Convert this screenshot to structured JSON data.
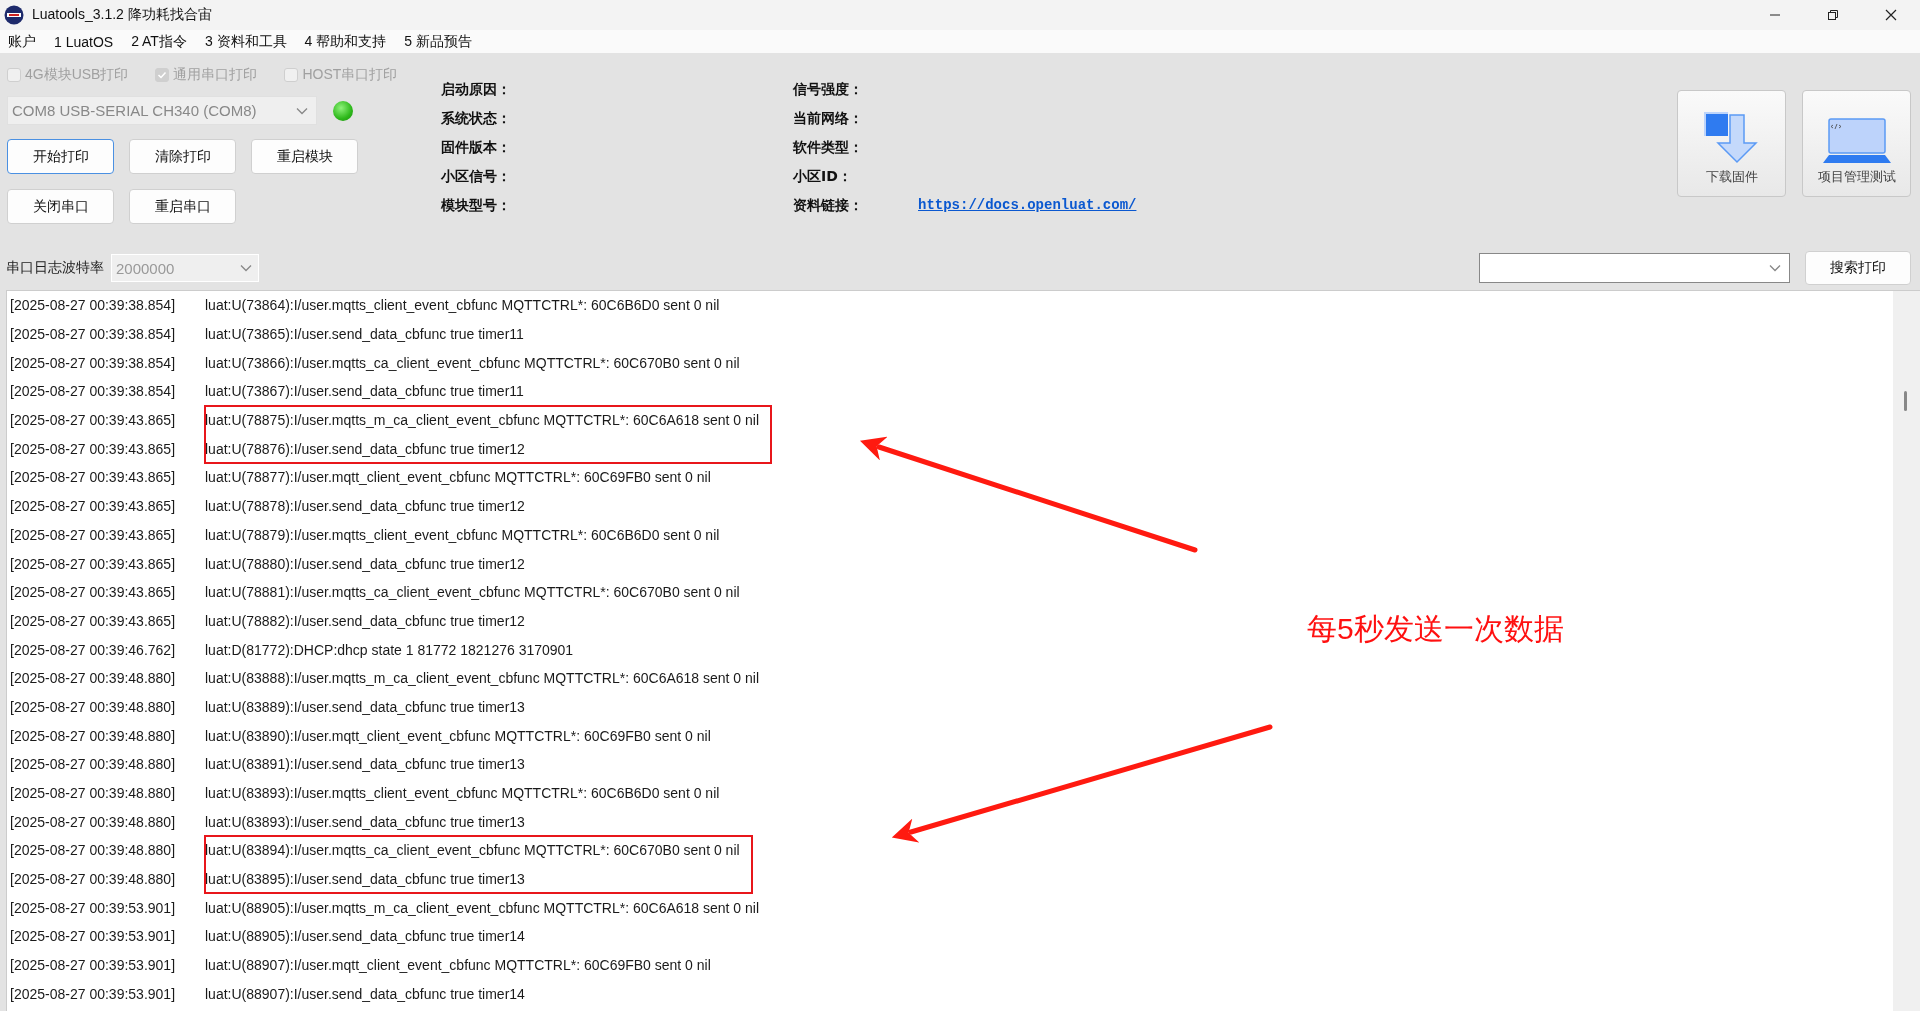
{
  "window": {
    "title": "Luatools_3.1.2 降功耗找合宙"
  },
  "menu": [
    "账户",
    "1 LuatOS",
    "2 AT指令",
    "3 资料和工具",
    "4 帮助和支持",
    "5 新品预告"
  ],
  "print_options": [
    {
      "label": "4G模块USB打印",
      "checked": false,
      "disabled": true
    },
    {
      "label": "通用串口打印",
      "checked": true,
      "disabled": true
    },
    {
      "label": "HOST串口打印",
      "checked": false,
      "disabled": true
    }
  ],
  "port": {
    "value": "COM8 USB-SERIAL CH340 (COM8)",
    "disabled": true,
    "connected": true
  },
  "buttons": [
    [
      {
        "label": "开始打印",
        "focused": true
      },
      {
        "label": "清除打印",
        "focused": false
      },
      {
        "label": "重启模块",
        "focused": false
      }
    ],
    [
      {
        "label": "关闭串口",
        "focused": false
      },
      {
        "label": "重启串口",
        "focused": false
      }
    ]
  ],
  "status_left": [
    "启动原因：",
    "系统状态：",
    "固件版本：",
    "小区信号：",
    "模块型号："
  ],
  "status_right": [
    {
      "label": "信号强度："
    },
    {
      "label": "当前网络："
    },
    {
      "label": "软件类型："
    },
    {
      "label": "小区ID："
    },
    {
      "label": "资料链接：",
      "link": "https://docs.openluat.com/"
    }
  ],
  "tools": [
    {
      "kind": "download",
      "label": "下载固件"
    },
    {
      "kind": "project",
      "label": "项目管理测试"
    }
  ],
  "baud": {
    "label": "串口日志波特率",
    "value": "2000000"
  },
  "search": {
    "button": "搜索打印"
  },
  "log": [
    {
      "timestamp": "[2025-08-27 00:39:38.854]",
      "message": "luat:U(73864):I/user.mqtts_client_event_cbfunc MQTTCTRL*: 60C6B6D0 sent 0 nil",
      "highlighted": false
    },
    {
      "timestamp": "[2025-08-27 00:39:38.854]",
      "message": "luat:U(73865):I/user.send_data_cbfunc true timer11",
      "highlighted": false
    },
    {
      "timestamp": "[2025-08-27 00:39:38.854]",
      "message": "luat:U(73866):I/user.mqtts_ca_client_event_cbfunc MQTTCTRL*: 60C670B0 sent 0 nil",
      "highlighted": false
    },
    {
      "timestamp": "[2025-08-27 00:39:38.854]",
      "message": "luat:U(73867):I/user.send_data_cbfunc true timer11",
      "highlighted": false
    },
    {
      "timestamp": "[2025-08-27 00:39:43.865]",
      "message": "luat:U(78875):I/user.mqtts_m_ca_client_event_cbfunc MQTTCTRL*: 60C6A618 sent 0 nil",
      "highlighted": true
    },
    {
      "timestamp": "[2025-08-27 00:39:43.865]",
      "message": "luat:U(78876):I/user.send_data_cbfunc true timer12",
      "highlighted": true
    },
    {
      "timestamp": "[2025-08-27 00:39:43.865]",
      "message": "luat:U(78877):I/user.mqtt_client_event_cbfunc MQTTCTRL*: 60C69FB0 sent 0 nil",
      "highlighted": false
    },
    {
      "timestamp": "[2025-08-27 00:39:43.865]",
      "message": "luat:U(78878):I/user.send_data_cbfunc true timer12",
      "highlighted": false
    },
    {
      "timestamp": "[2025-08-27 00:39:43.865]",
      "message": "luat:U(78879):I/user.mqtts_client_event_cbfunc MQTTCTRL*: 60C6B6D0 sent 0 nil",
      "highlighted": false
    },
    {
      "timestamp": "[2025-08-27 00:39:43.865]",
      "message": "luat:U(78880):I/user.send_data_cbfunc true timer12",
      "highlighted": false
    },
    {
      "timestamp": "[2025-08-27 00:39:43.865]",
      "message": "luat:U(78881):I/user.mqtts_ca_client_event_cbfunc MQTTCTRL*: 60C670B0 sent 0 nil",
      "highlighted": false
    },
    {
      "timestamp": "[2025-08-27 00:39:43.865]",
      "message": "luat:U(78882):I/user.send_data_cbfunc true timer12",
      "highlighted": false
    },
    {
      "timestamp": "[2025-08-27 00:39:46.762]",
      "message": "luat:D(81772):DHCP:dhcp state 1 81772 1821276 3170901",
      "highlighted": false
    },
    {
      "timestamp": "[2025-08-27 00:39:48.880]",
      "message": "luat:U(83888):I/user.mqtts_m_ca_client_event_cbfunc MQTTCTRL*: 60C6A618 sent 0 nil",
      "highlighted": false
    },
    {
      "timestamp": "[2025-08-27 00:39:48.880]",
      "message": "luat:U(83889):I/user.send_data_cbfunc true timer13",
      "highlighted": false
    },
    {
      "timestamp": "[2025-08-27 00:39:48.880]",
      "message": "luat:U(83890):I/user.mqtt_client_event_cbfunc MQTTCTRL*: 60C69FB0 sent 0 nil",
      "highlighted": false
    },
    {
      "timestamp": "[2025-08-27 00:39:48.880]",
      "message": "luat:U(83891):I/user.send_data_cbfunc true timer13",
      "highlighted": false
    },
    {
      "timestamp": "[2025-08-27 00:39:48.880]",
      "message": "luat:U(83893):I/user.mqtts_client_event_cbfunc MQTTCTRL*: 60C6B6D0 sent 0 nil",
      "highlighted": false
    },
    {
      "timestamp": "[2025-08-27 00:39:48.880]",
      "message": "luat:U(83893):I/user.send_data_cbfunc true timer13",
      "highlighted": false
    },
    {
      "timestamp": "[2025-08-27 00:39:48.880]",
      "message": "luat:U(83894):I/user.mqtts_ca_client_event_cbfunc MQTTCTRL*: 60C670B0 sent 0 nil",
      "highlighted": true
    },
    {
      "timestamp": "[2025-08-27 00:39:48.880]",
      "message": "luat:U(83895):I/user.send_data_cbfunc true timer13",
      "highlighted": true
    },
    {
      "timestamp": "[2025-08-27 00:39:53.901]",
      "message": "luat:U(88905):I/user.mqtts_m_ca_client_event_cbfunc MQTTCTRL*: 60C6A618 sent 0 nil",
      "highlighted": false
    },
    {
      "timestamp": "[2025-08-27 00:39:53.901]",
      "message": "luat:U(88905):I/user.send_data_cbfunc true timer14",
      "highlighted": false
    },
    {
      "timestamp": "[2025-08-27 00:39:53.901]",
      "message": "luat:U(88907):I/user.mqtt_client_event_cbfunc MQTTCTRL*: 60C69FB0 sent 0 nil",
      "highlighted": false
    },
    {
      "timestamp": "[2025-08-27 00:39:53.901]",
      "message": "luat:U(88907):I/user.send_data_cbfunc true timer14",
      "highlighted": false
    }
  ],
  "annotation": {
    "text": "每5秒发送一次数据"
  }
}
